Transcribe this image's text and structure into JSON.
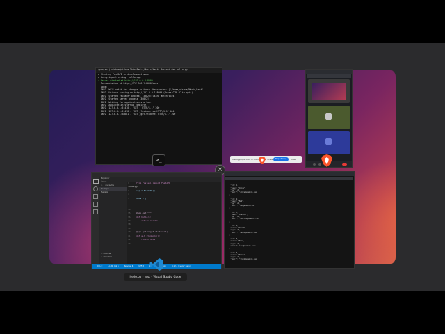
{
  "terminal": {
    "title": "(project) vishwa@vishwa-ThinkPad:~/Music/test$ fastapi dev hello.py",
    "lines": [
      "☒ Starting FastAPI in development mode",
      "",
      "☒ Using import string: hello:app",
      "",
      "☒ Server started at http://127.0.0.1:8000",
      "  Documentation at http://127.0.0.1:8000/docs",
      "",
      "  Logs:",
      "",
      "  INFO  Will watch for changes in these directories: ['/home/vishwa/Music/test']",
      "  INFO  Uvicorn running on http://127.0.0.1:8000 (Press CTRL+C to quit)",
      "  INFO  Started reloader process [30820] using WatchFiles",
      "  INFO  Started server process [30822]",
      "  INFO  Waiting for application startup.",
      "  INFO  Application startup complete.",
      "  INFO  127.0.0.1:51478 - \"GET / HTTP/1.1\" 200",
      "  INFO  127.0.0.1:51478 - \"GET /favicon.ico HTTP/1.1\" 404",
      "  INFO  127.0.0.1:38681 - \"GET /get-students HTTP/1.1\" 200"
    ],
    "dock_icon": ">_"
  },
  "share_bar": {
    "text": "meet.google.com is sharing your screen",
    "stop_label": "Stop sharing",
    "hide_label": "Hide"
  },
  "close_label": "×",
  "vscode": {
    "sidebar": [
      "Explorer",
      "˅ test",
      "  > __pycache__",
      "  hello.py",
      "  fastapi"
    ],
    "sidebar_bottom": [
      "> Outline",
      "> Timeline"
    ],
    "tab": "hello.py",
    "code": [
      {
        "n": "1",
        "t": "from fastapi import FastAPI"
      },
      {
        "n": "2",
        "t": ""
      },
      {
        "n": "3",
        "t": "app = FastAPI()"
      },
      {
        "n": "4",
        "t": ""
      },
      {
        "n": "5",
        "t": "data = ["
      },
      {
        "n": "",
        "t": ""
      },
      {
        "n": "",
        "t": ""
      },
      {
        "n": "34",
        "t": ""
      },
      {
        "n": "35",
        "t": "@app.get(\"/\")"
      },
      {
        "n": "36",
        "t": "def hello():"
      },
      {
        "n": "37",
        "t": "    return \"test\""
      },
      {
        "n": "38",
        "t": ""
      },
      {
        "n": "39",
        "t": ""
      },
      {
        "n": "40",
        "t": "@app.get(\"/get-students\")"
      },
      {
        "n": "41",
        "t": "def all_students():"
      },
      {
        "n": "42",
        "t": "    return data"
      },
      {
        "n": "43",
        "t": ""
      }
    ],
    "status": [
      "0 ⚠ 0",
      "Ln 34, Col 1",
      "Spaces: 4",
      "UTF-8",
      "LF",
      "{} Python",
      "3.12.3 ('.venv': venv)"
    ],
    "caption": "hello.py - test - Visual Studio Code"
  },
  "json_lines": [
    "[",
    "  {",
    "    \"id\": 1,",
    "    \"name\": \"Alice\",",
    "    \"age\": 20,",
    "    \"email\": \"alice@example.com\"",
    "  },",
    "  {",
    "    \"id\": 2,",
    "    \"name\": \"Bob\",",
    "    \"age\": 22,",
    "    \"email\": \"bob@example.com\"",
    "  },",
    "  {",
    "    \"id\": 3,",
    "    \"name\": \"Charlie\",",
    "    \"age\": 21,",
    "    \"email\": \"charlie@example.com\"",
    "  },",
    "  {",
    "    \"id\": 4,",
    "    \"name\": \"David\",",
    "    \"age\": 23,",
    "    \"email\": \"david@example.com\"",
    "  },",
    "  {",
    "    \"id\": 5,",
    "    \"name\": \"Eve\",",
    "    \"age\": 20,",
    "    \"email\": \"eve@example.com\"",
    "  },",
    "  {",
    "    \"id\": 6,",
    "    \"name\": \"Frank\",",
    "    \"age\": 24,",
    "    \"email\": \"frank@example.com\"",
    "  }",
    "]"
  ],
  "colors": {
    "accent": "#007acc",
    "brave": "#fb542b",
    "share": "#1a73e8"
  }
}
